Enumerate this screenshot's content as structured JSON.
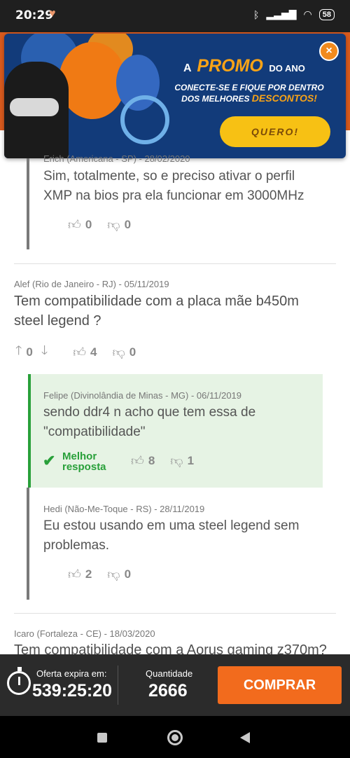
{
  "status_bar": {
    "time": "20:29",
    "battery": "58"
  },
  "banner": {
    "title_prefix": "A",
    "title_highlight": "PROMO",
    "title_suffix": "DO ANO",
    "subtitle_line1": "CONECTE-SE E FIQUE POR DENTRO",
    "subtitle_line2_prefix": "DOS MELHORES",
    "subtitle_line2_highlight": "DESCONTOS!",
    "cta": "QUERO!",
    "close": "×"
  },
  "answers": [
    {
      "author_meta": "Erich (Americana - SP) - 28/02/2020",
      "text": "Sim, totalmente, so e preciso ativar o perfil XMP na bios pra ela funcionar em 3000MHz",
      "likes": "0",
      "dislikes": "0"
    }
  ],
  "question": {
    "author_meta": "Alef (Rio de Janeiro - RJ) - 05/11/2019",
    "text": "Tem compatibilidade com a placa mãe b450m steel legend ?",
    "votes_up": "0",
    "likes": "4",
    "dislikes": "0"
  },
  "best_answer": {
    "author_meta": "Felipe (Divinolândia de Minas - MG) - 06/11/2019",
    "text": "sendo ddr4 n acho que tem essa de \"compatibilidade\"",
    "label_line1": "Melhor",
    "label_line2": "resposta",
    "likes": "8",
    "dislikes": "1"
  },
  "second_answer": {
    "author_meta": "Hedi (Não-Me-Toque - RS) - 28/11/2019",
    "text": "Eu estou usando em uma steel legend sem problemas.",
    "likes": "2",
    "dislikes": "0"
  },
  "next_question": {
    "author_meta": "Icaro (Fortaleza - CE) - 18/03/2020",
    "text": "Tem compatibilidade com a Aorus gaming z370m?"
  },
  "bottom_bar": {
    "offer_label": "Oferta expira em:",
    "offer_timer": "539:25:20",
    "qty_label": "Quantidade",
    "qty_value": "2666",
    "buy_label": "COMPRAR"
  }
}
